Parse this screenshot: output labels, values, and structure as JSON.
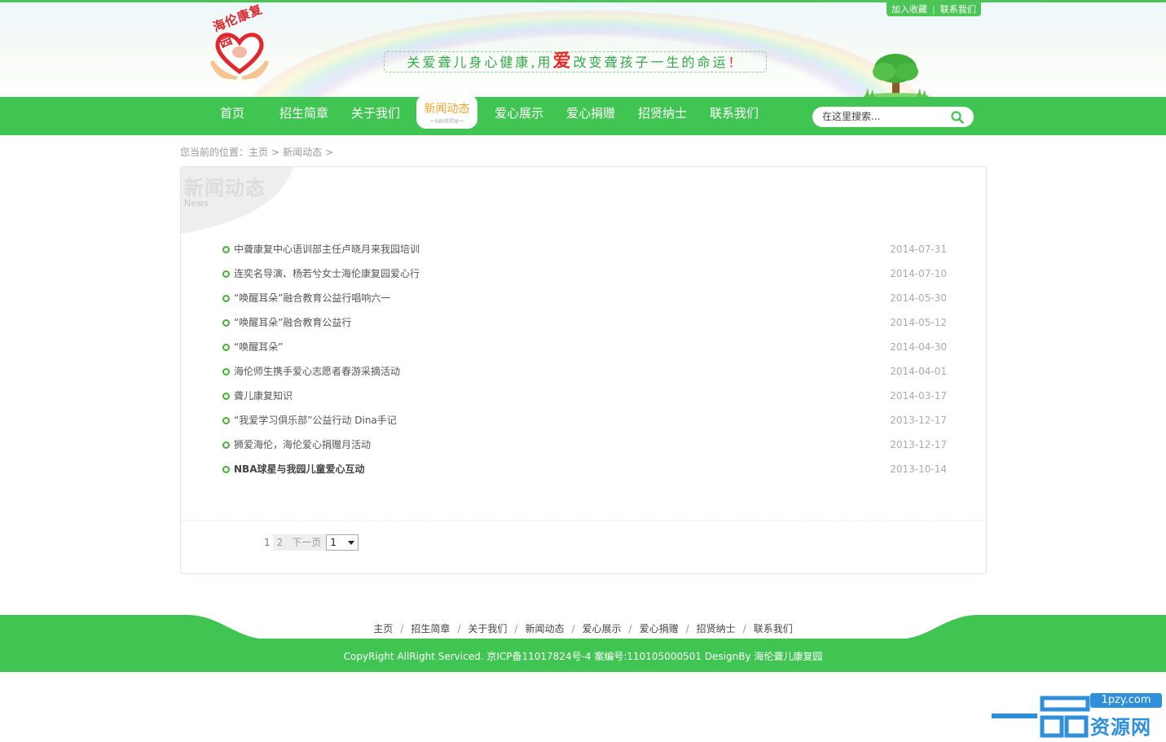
{
  "topbar": {
    "favorite": "加入收藏",
    "contact": "联系我们"
  },
  "logo": {
    "text": "海伦康复园"
  },
  "slogan": {
    "part1": "关爱聋儿身心健康,用",
    "love": "爱",
    "part2": "改变聋孩子一生的命运",
    "mark": "！"
  },
  "nav": {
    "items": [
      "首页",
      "招生简章",
      "关于我们",
      "新闻动态",
      "爱心展示",
      "爱心捐赠",
      "招贤纳士",
      "联系我们"
    ],
    "active_sub": "~seotitle~"
  },
  "search": {
    "placeholder": "在这里搜索..."
  },
  "breadcrumb": {
    "prefix": "您当前的位置：",
    "home": "主页",
    "sep1": ">",
    "current": "新闻动态",
    "sep2": ">"
  },
  "panel": {
    "title": "新闻动态",
    "subtitle": "News"
  },
  "news": [
    {
      "title": "中聋康复中心语训部主任卢晓月来我园培训",
      "date": "2014-07-31"
    },
    {
      "title": "连奕名导演、杨若兮女士海伦康复园爱心行",
      "date": "2014-07-10"
    },
    {
      "title": "“唤醒耳朵”融合教育公益行唱响六一",
      "date": "2014-05-30"
    },
    {
      "title": "“唤醒耳朵”融合教育公益行",
      "date": "2014-05-12"
    },
    {
      "title": "“唤醒耳朵”",
      "date": "2014-04-30"
    },
    {
      "title": "海伦师生携手爱心志愿者春游采摘活动",
      "date": "2014-04-01"
    },
    {
      "title": "聋儿康复知识",
      "date": "2014-03-17"
    },
    {
      "title": "“我爱学习俱乐部”公益行动 Dina手记",
      "date": "2013-12-17"
    },
    {
      "title": "狮爱海伦，海伦爱心捐赠月活动",
      "date": "2013-12-17"
    },
    {
      "title": "NBA球星与我园儿童爱心互动",
      "date": "2013-10-14"
    }
  ],
  "pager": {
    "current": "1",
    "page2": "2",
    "next": "下一页",
    "select_value": "1"
  },
  "footer": {
    "links": [
      "主页",
      "招生简章",
      "关于我们",
      "新闻动态",
      "爱心展示",
      "爱心捐赠",
      "招贤纳士",
      "联系我们"
    ],
    "sep": "/",
    "copyright": "CopyRight AllRight Serviced. 京ICP备11017824号-4 案编号:110105000501 DesignBy 海伦聋儿康复园"
  },
  "watermark": {
    "url": "1pzy.com",
    "text": "资源网"
  },
  "colors": {
    "brand_green": "#41c552",
    "active_orange": "#f5a524",
    "date_gray": "#aaaaaa"
  }
}
